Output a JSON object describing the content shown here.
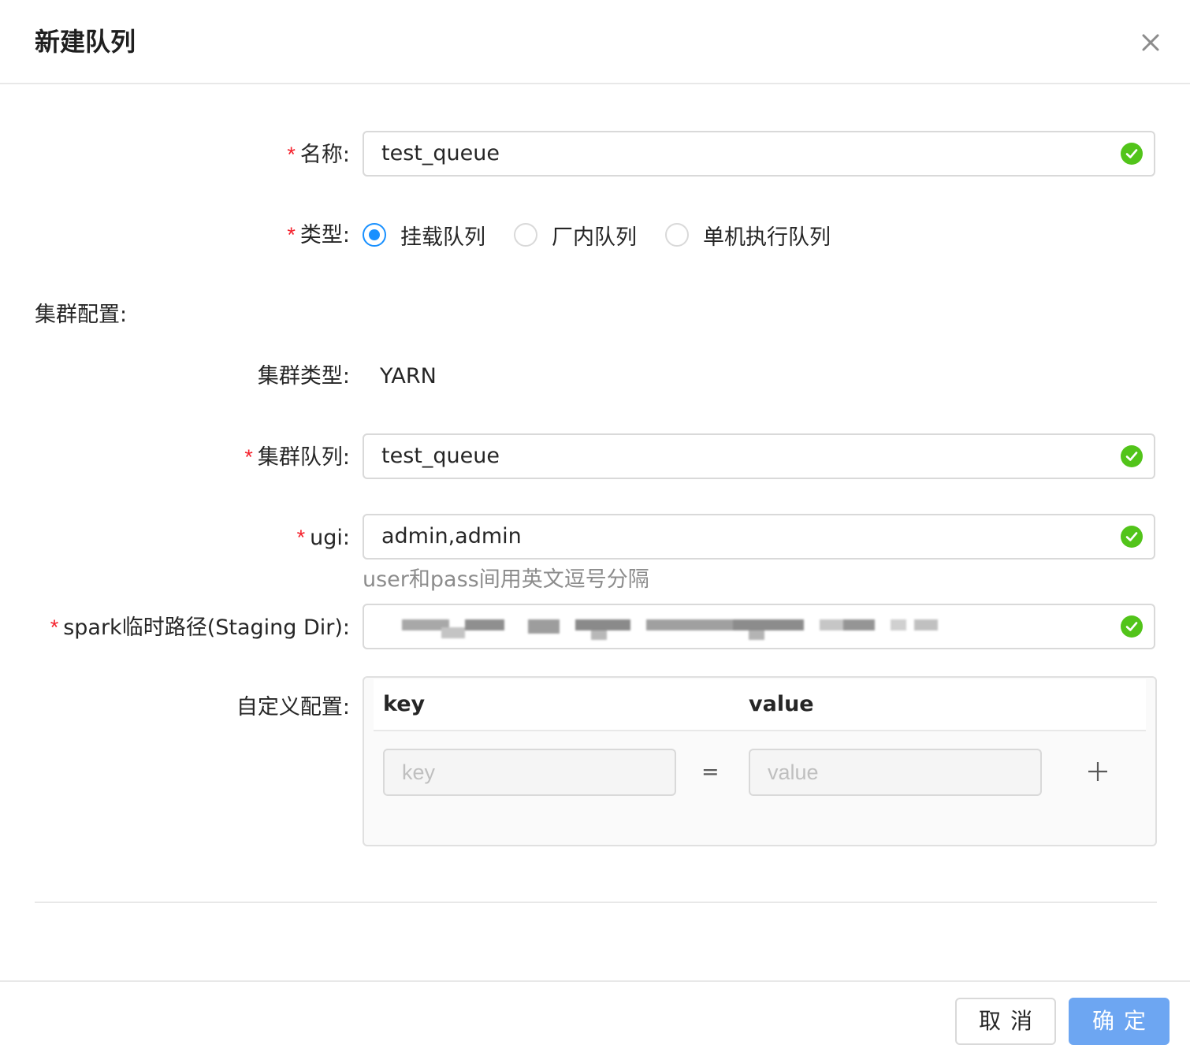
{
  "modal": {
    "title": "新建队列"
  },
  "form": {
    "name": {
      "label": "名称:",
      "value": "test_queue",
      "valid": true
    },
    "type": {
      "label": "类型:",
      "options": [
        "挂载队列",
        "厂内队列",
        "单机执行队列"
      ],
      "selected": "挂载队列"
    },
    "cluster_section_label": "集群配置:",
    "cluster_type": {
      "label": "集群类型:",
      "value": "YARN"
    },
    "cluster_queue": {
      "label": "集群队列:",
      "value": "test_queue",
      "valid": true
    },
    "ugi": {
      "label": "ugi:",
      "value": "admin,admin",
      "help": "user和pass间用英文逗号分隔",
      "valid": true
    },
    "staging_dir": {
      "label": "spark临时路径(Staging Dir):",
      "valid": true
    },
    "custom_config": {
      "label": "自定义配置:",
      "columns": {
        "key": "key",
        "value": "value"
      },
      "key_placeholder": "key",
      "value_placeholder": "value",
      "separator": "="
    }
  },
  "footer": {
    "cancel_label": "取消",
    "ok_label": "确定"
  },
  "colors": {
    "required": "#f5222d",
    "primary": "#1890ff",
    "success": "#52c41a",
    "ok_button": "#6da6f2"
  }
}
